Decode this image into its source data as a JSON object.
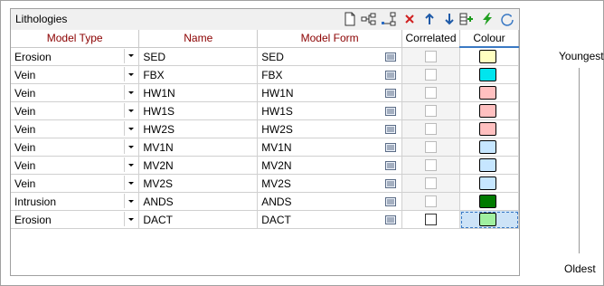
{
  "panel": {
    "title": "Lithologies"
  },
  "toolbar": [
    {
      "name": "new-icon",
      "glyph": "new"
    },
    {
      "name": "hierarchy-icon",
      "glyph": "tree"
    },
    {
      "name": "hierarchy-down-icon",
      "glyph": "tree2"
    },
    {
      "name": "delete-icon",
      "glyph": "x"
    },
    {
      "name": "move-up-icon",
      "glyph": "up"
    },
    {
      "name": "move-down-icon",
      "glyph": "down"
    },
    {
      "name": "insert-row-icon",
      "glyph": "ins"
    },
    {
      "name": "lightning-icon",
      "glyph": "bolt"
    },
    {
      "name": "refresh-icon",
      "glyph": "refresh"
    }
  ],
  "columns": [
    "Model Type",
    "Name",
    "Model Form",
    "Correlated",
    "Colour"
  ],
  "rows": [
    {
      "type": "Erosion",
      "name": "SED",
      "form": "SED",
      "correlated": false,
      "active": false,
      "colour": "#ffffc0"
    },
    {
      "type": "Vein",
      "name": "FBX",
      "form": "FBX",
      "correlated": false,
      "active": false,
      "colour": "#00e5ee"
    },
    {
      "type": "Vein",
      "name": "HW1N",
      "form": "HW1N",
      "correlated": false,
      "active": false,
      "colour": "#ffc0c0"
    },
    {
      "type": "Vein",
      "name": "HW1S",
      "form": "HW1S",
      "correlated": false,
      "active": false,
      "colour": "#ffc0c0"
    },
    {
      "type": "Vein",
      "name": "HW2S",
      "form": "HW2S",
      "correlated": false,
      "active": false,
      "colour": "#ffc0c0"
    },
    {
      "type": "Vein",
      "name": "MV1N",
      "form": "MV1N",
      "correlated": false,
      "active": false,
      "colour": "#c6e6ff"
    },
    {
      "type": "Vein",
      "name": "MV2N",
      "form": "MV2N",
      "correlated": false,
      "active": false,
      "colour": "#c6e6ff"
    },
    {
      "type": "Vein",
      "name": "MV2S",
      "form": "MV2S",
      "correlated": false,
      "active": false,
      "colour": "#c6e6ff"
    },
    {
      "type": "Intrusion",
      "name": "ANDS",
      "form": "ANDS",
      "correlated": false,
      "active": false,
      "colour": "#007a00"
    },
    {
      "type": "Erosion",
      "name": "DACT",
      "form": "DACT",
      "correlated": false,
      "active": true,
      "colour": "#a0f0a0",
      "selected": true
    }
  ],
  "side": {
    "top_label": "Youngest",
    "bottom_label": "Oldest"
  }
}
